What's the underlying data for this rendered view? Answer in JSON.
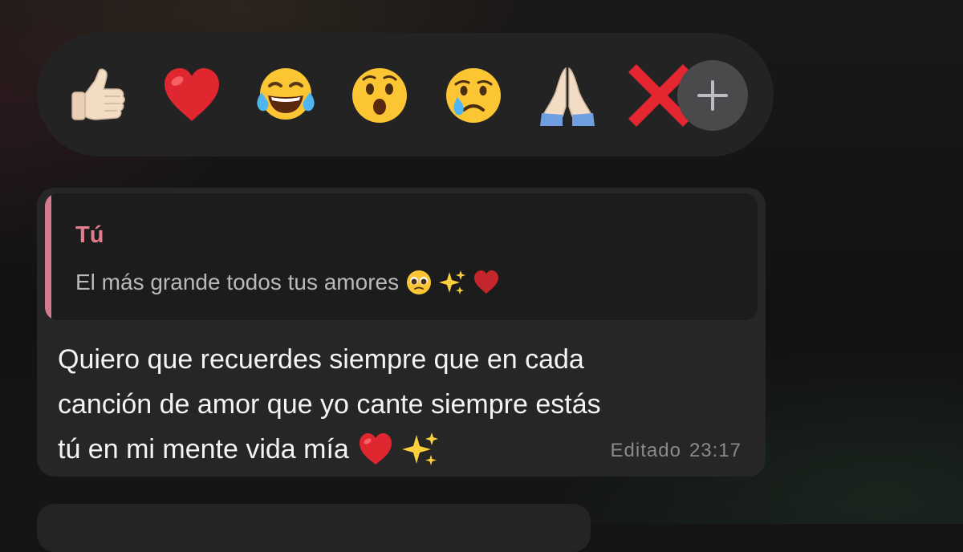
{
  "reactions": {
    "emojis": [
      "thumbs-up",
      "red-heart",
      "tears-of-joy",
      "surprised-face",
      "crying-face",
      "folded-hands",
      "cross-mark"
    ]
  },
  "message": {
    "reply": {
      "author": "Tú",
      "text": "El más grande todos tus amores"
    },
    "body_lines": [
      "Quiero que recuerdes siempre que en cada",
      "canción de amor que yo cante siempre estás",
      "tú en mi mente vida mía"
    ],
    "edited_label": "Editado",
    "time": "23:17"
  },
  "colors": {
    "accent": "#e07e91",
    "quote_bar": "#d67b8d",
    "bubble": "#262626",
    "reaction_bar": "#232323"
  }
}
